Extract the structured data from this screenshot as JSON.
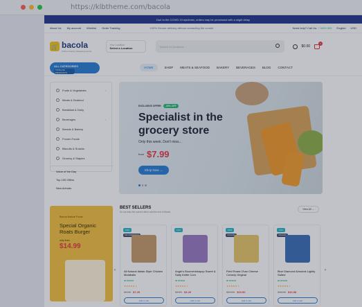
{
  "browser": {
    "url": "https://klbtheme.com/bacola"
  },
  "promo_bar": "Due to the COVID 19 epidemic, orders may be processed with a slight delay",
  "topbar": {
    "links": [
      "About Us",
      "My account",
      "Wishlist",
      "Order Tracking"
    ],
    "secure": "100% Secure delivery without contacting the courier",
    "help": "Need help? Call Us:",
    "phone": "+ 0020 500",
    "language": "English",
    "currency": "USD"
  },
  "header": {
    "logo_name": "bacola",
    "logo_tagline": "Online Grocery Shopping Center",
    "location_label": "Your Location",
    "location_value": "Select a Location",
    "search_placeholder": "Search for products...",
    "cart_total": "$0.00",
    "cart_count": "0"
  },
  "nav": {
    "all_categories": "ALL CATEGORIES",
    "products_count": "TOTAL 63 PRODUCTS",
    "links": [
      "HOME",
      "SHOP",
      "MEATS & SEAFOOD",
      "BAKERY",
      "BEVERAGES",
      "BLOG",
      "CONTACT"
    ]
  },
  "categories": [
    "Fruits & Vegetables",
    "Meats & Seafood",
    "Breakfast & Dairy",
    "Beverages",
    "Breads & Bakery",
    "Frozen Foods",
    "Biscuits & Snacks",
    "Grocery & Staples"
  ],
  "side_links": [
    "Value of the Day",
    "Top 100 Offers",
    "New Arrivals"
  ],
  "hero": {
    "offer_label": "EXCLUSIVE OFFER",
    "offer_badge": "-20% OFF",
    "title": "Specialist in the grocery store",
    "desc": "Only this week. Don't miss...",
    "from": "from",
    "price": "$7.99",
    "button": "Shop Now →"
  },
  "side_banner": {
    "kicker": "Bacola Natural Foods",
    "title": "Special Organic Roats Burger",
    "only_from": "only-from",
    "price": "$14.99"
  },
  "best_sellers": {
    "title": "BEST SELLERS",
    "subtitle": "Do not miss the current offers until the end of March.",
    "view_all": "View All →",
    "products": [
      {
        "pct": "19%",
        "tag": "RECOMMENDED",
        "name": "All Natural Italian-Style Chicken Meatballs",
        "stock": "IN STOCK",
        "stars": "★★★★★ 1",
        "old": "$9.35",
        "new": "$7.25",
        "color": "#c79a6a"
      },
      {
        "pct": "14%",
        "tag": "",
        "name": "Angie's Boomchickapop Sweet & Salty Kettle Corn",
        "stock": "IN STOCK",
        "stars": "★★★★★ 1",
        "old": "$4.29",
        "new": "$3.29",
        "color": "#9b7bc4"
      },
      {
        "pct": "15%",
        "tag": "ORGANIC",
        "name": "Field Roast Chao Cheese Creamy Original",
        "stock": "IN STOCK",
        "stars": "★★★★★ 1",
        "old": "$24.00",
        "new": "$19.50",
        "color": "#e8c76a"
      },
      {
        "pct": "11%",
        "tag": "ORGANIC",
        "name": "Blue Diamond Almonds Lightly Salted",
        "stock": "IN STOCK",
        "stars": "★★★★★ 1",
        "old": "$11.68",
        "new": "$10.58",
        "color": "#3d6fb8"
      }
    ],
    "add_to_cart": "Add to cart"
  }
}
